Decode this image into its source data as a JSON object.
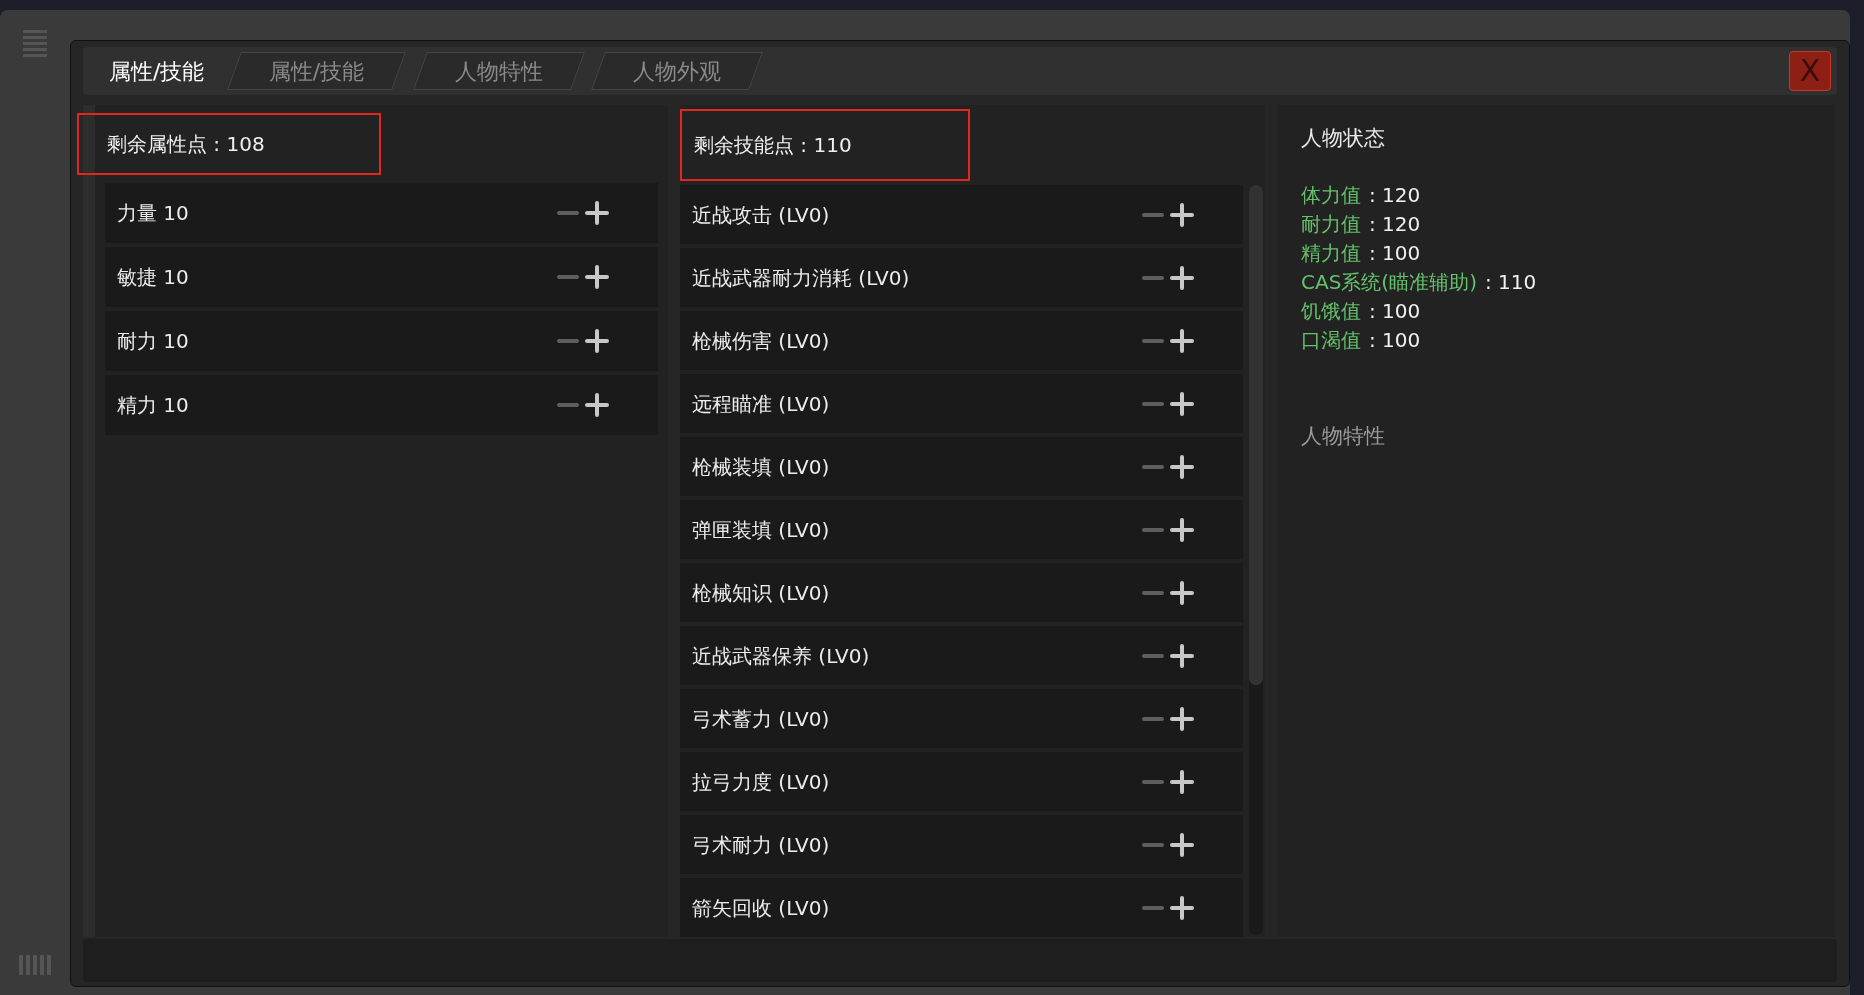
{
  "tabs": [
    {
      "label": "属性/技能",
      "selected": true
    },
    {
      "label": "属性/技能",
      "selected": false
    },
    {
      "label": "人物特性",
      "selected": false
    },
    {
      "label": "人物外观",
      "selected": false
    }
  ],
  "close_button": {
    "label": "X"
  },
  "attributes": {
    "header": "剩余属性点 : 108",
    "highlighted": true,
    "rows": [
      {
        "label": "力量 10"
      },
      {
        "label": "敏捷 10"
      },
      {
        "label": "耐力 10"
      },
      {
        "label": "精力 10"
      }
    ]
  },
  "skills": {
    "header": "剩余技能点 : 110",
    "highlighted": true,
    "rows": [
      {
        "label": "近战攻击 (LV0)"
      },
      {
        "label": "近战武器耐力消耗 (LV0)"
      },
      {
        "label": "枪械伤害 (LV0)"
      },
      {
        "label": "远程瞄准 (LV0)"
      },
      {
        "label": "枪械装填 (LV0)"
      },
      {
        "label": "弹匣装填 (LV0)"
      },
      {
        "label": "枪械知识 (LV0)"
      },
      {
        "label": "近战武器保养 (LV0)"
      },
      {
        "label": "弓术蓄力 (LV0)"
      },
      {
        "label": "拉弓力度 (LV0)"
      },
      {
        "label": "弓术耐力 (LV0)"
      },
      {
        "label": "箭矢回收 (LV0)"
      }
    ]
  },
  "status": {
    "title": "人物状态",
    "stats": [
      {
        "label": "体力值",
        "value": ": 120"
      },
      {
        "label": "耐力值",
        "value": ": 120"
      },
      {
        "label": "精力值",
        "value": ": 100"
      },
      {
        "label": "CAS系统(瞄准辅助)",
        "value": ": 110"
      },
      {
        "label": "饥饿值",
        "value": ": 100"
      },
      {
        "label": "口渴值",
        "value": ": 100"
      }
    ],
    "traits_title": "人物特性"
  }
}
